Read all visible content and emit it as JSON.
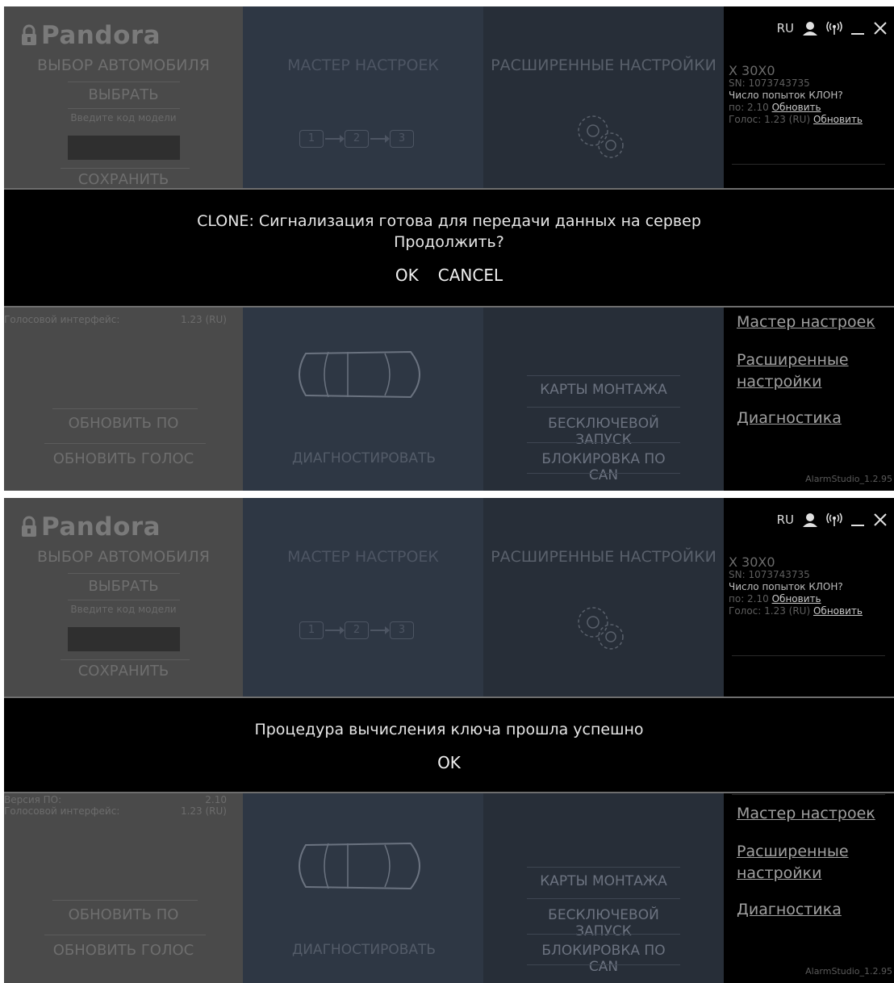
{
  "app": {
    "logo_text": "Pandora",
    "version": "AlarmStudio_1.2.95"
  },
  "column1": {
    "title": "ВЫБОР АВТОМОБИЛЯ",
    "select_label": "ВЫБРАТЬ",
    "model_hint": "Введите код модели",
    "save_label": "СОХРАНИТЬ",
    "update_fw_label": "ОБНОВИТЬ ПО",
    "update_voice_label": "ОБНОВИТЬ ГОЛОС",
    "info": [
      {
        "label": "Версия ПО:",
        "value": "2.10"
      },
      {
        "label": "Голосовой интерфейс:",
        "value": "1.23 (RU)"
      }
    ]
  },
  "column2": {
    "title": "МАСТЕР НАСТРОЕК",
    "steps": [
      "1",
      "2",
      "3"
    ],
    "diagnose_label": "ДИАГНОСТИРОВАТЬ"
  },
  "column3": {
    "title": "РАСШИРЕННЫЕ НАСТРОЙКИ",
    "buttons": [
      "КАРТЫ МОНТАЖА",
      "БЕСКЛЮЧЕВОЙ ЗАПУСК",
      "БЛОКИРОВКА ПО CAN"
    ]
  },
  "sidebar": {
    "lang": "RU",
    "device_name": "X 30X0",
    "sn": "SN: 1073743735",
    "clone_attempts": "Число попыток КЛОН?",
    "fw_prefix": "по: 2.10",
    "voice_prefix": "Голос: 1.23 (RU)",
    "update_link": "Обновить",
    "menu": [
      "Мастер настроек",
      "Расширенные настройки",
      "Диагностика"
    ]
  },
  "dialog_top": {
    "line1": "CLONE: Сигнализация готова для передачи данных на сервер",
    "line2": "Продолжить?",
    "ok": "OK",
    "cancel": "CANCEL"
  },
  "dialog_bottom": {
    "line1": "Процедура вычисления ключа прошла успешно",
    "ok": "OK"
  }
}
